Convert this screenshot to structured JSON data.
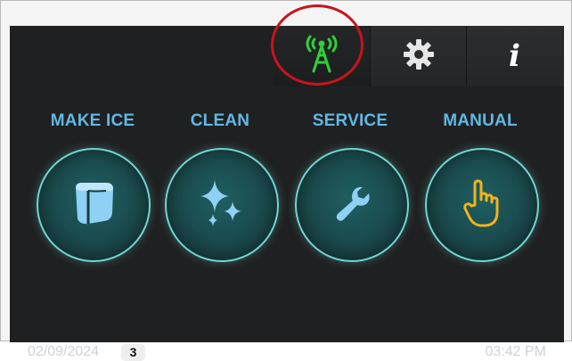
{
  "toolbar": {
    "buttons": [
      {
        "name": "network",
        "icon": "antenna-icon",
        "color": "#2fcf3a"
      },
      {
        "name": "settings",
        "icon": "gear-icon",
        "color": "#e6e6e6"
      },
      {
        "name": "info",
        "icon": "info-icon",
        "glyph": "i",
        "color": "#ffffff"
      }
    ],
    "highlight_color": "#c8141c"
  },
  "functions": [
    {
      "label": "MAKE ICE",
      "icon": "ice-cube-icon",
      "icon_color": "#8fd0f5"
    },
    {
      "label": "CLEAN",
      "icon": "sparkle-icon",
      "icon_color": "#8fd0f5"
    },
    {
      "label": "SERVICE",
      "icon": "wrench-icon",
      "icon_color": "#8fd0f5"
    },
    {
      "label": "MANUAL",
      "icon": "hand-pointer-icon",
      "icon_color": "#f2b21c"
    }
  ],
  "status_bar": {
    "date": "02/09/2024",
    "badge": "3",
    "time": "03:42 PM"
  },
  "colors": {
    "screen_bg": "#1f2021",
    "label": "#5fb8e6",
    "button_ring": "#6fd6d2"
  }
}
